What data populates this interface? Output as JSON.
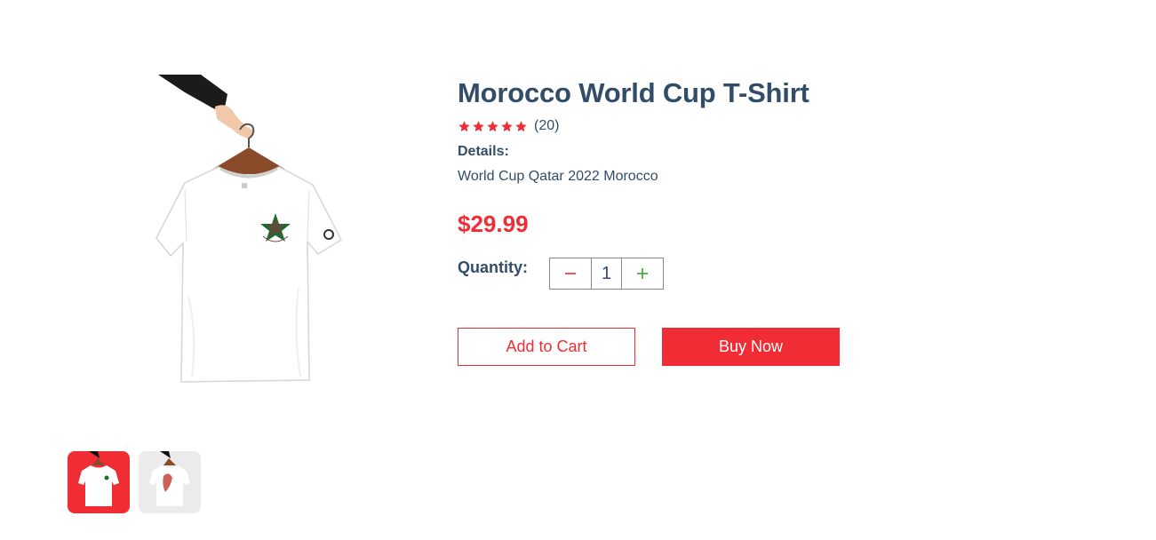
{
  "product": {
    "title": "Morocco World Cup T-Shirt",
    "rating": 5,
    "review_count": "(20)",
    "details_heading": "Details:",
    "details_text": "World Cup Qatar 2022 Morocco",
    "price": "$29.99",
    "quantity_label": "Quantity:",
    "quantity_value": "1"
  },
  "actions": {
    "add_to_cart": "Add to Cart",
    "buy_now": "Buy Now"
  },
  "thumbnails": [
    {
      "name": "tshirt-front",
      "active": true
    },
    {
      "name": "tshirt-back",
      "active": false
    }
  ],
  "colors": {
    "accent": "#f02d34",
    "text": "#324d67",
    "plus": "#31a831",
    "thumb_inactive_bg": "#ebebeb"
  },
  "icons": {
    "star": "star-icon",
    "minus": "minus-icon",
    "plus": "plus-icon"
  }
}
